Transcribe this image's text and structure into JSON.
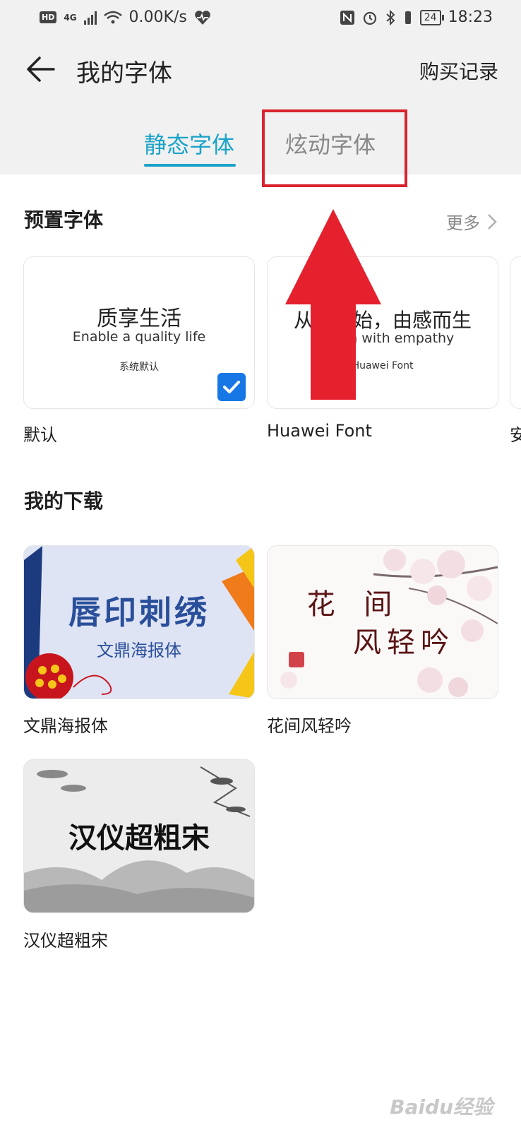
{
  "status_bar": {
    "hd": "HD",
    "network": "4G",
    "speed": "0.00K/s",
    "battery": "24",
    "time": "18:23",
    "icons": [
      "wifi-icon",
      "heartbeat-icon",
      "nfc-icon",
      "alarm-icon",
      "bluetooth-icon",
      "battery-icon"
    ]
  },
  "header": {
    "title": "我的字体",
    "purchase_label": "购买记录"
  },
  "tabs": [
    {
      "label": "静态字体",
      "selected": true
    },
    {
      "label": "炫动字体",
      "selected": false
    }
  ],
  "preset": {
    "title": "预置字体",
    "more_label": "更多",
    "cards": [
      {
        "main": "质享生活",
        "sub": "Enable a quality life",
        "tag": "系统默认",
        "name": "默认",
        "checked": true
      },
      {
        "main": "从心开始，由感而生",
        "sub": "Design with empathy",
        "tag": "Huawei Font",
        "name": "Huawei Font",
        "checked": false
      },
      {
        "name": "安"
      }
    ]
  },
  "downloads": {
    "title": "我的下载",
    "cards": [
      {
        "art_title": "唇印刺绣",
        "art_sub": "文鼎海报体",
        "name": "文鼎海报体"
      },
      {
        "art_line1": "花 间",
        "art_line2": "风轻吟",
        "seal": "花",
        "name": "花间风轻吟"
      },
      {
        "art_title": "汉仪超粗宋",
        "name": "汉仪超粗宋"
      }
    ]
  },
  "watermark": "Baidu经验",
  "colors": {
    "accent": "#1aa3c8",
    "highlight": "#d9232e",
    "check": "#1777e5"
  }
}
